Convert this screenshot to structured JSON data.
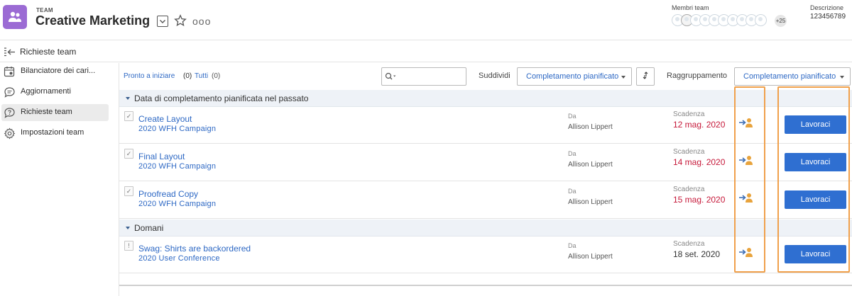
{
  "header": {
    "kicker": "TEAM",
    "title": "Creative Marketing",
    "more_glyph": "ooo",
    "members_label": "Membri team",
    "members_extra": "+25",
    "description_label": "Descrizione",
    "description_value": "123456789"
  },
  "breadcrumb": {
    "label": "Richieste team"
  },
  "sidebar": {
    "items": [
      {
        "label": "Bilanciatore dei cari...",
        "icon": "calendar-people-icon",
        "active": false
      },
      {
        "label": "Aggiornamenti",
        "icon": "speech-bubble-icon",
        "active": false
      },
      {
        "label": "Richieste team",
        "icon": "request-bubble-icon",
        "active": true
      },
      {
        "label": "Impostazioni team",
        "icon": "gear-icon",
        "active": false
      }
    ]
  },
  "toolbar": {
    "filter_ready": "Pronto a iniziare",
    "filter_ready_count": "(0)",
    "filter_all": "Tutti",
    "filter_all_count": "(0)",
    "search_value": "",
    "sort_label": "Suddividi",
    "sort_value": "Completamento pianificato",
    "group_label": "Raggruppamento",
    "group_value": "Completamento pianificato"
  },
  "groups": [
    {
      "title": "Data di completamento pianificata nel passato",
      "rows": [
        {
          "icon_glyph": "✓",
          "title": "Create Layout",
          "project": "2020 WFH Campaign",
          "from_label": "Da",
          "from": "Allison Lippert",
          "due_label": "Scadenza",
          "due": "12 mag. 2020",
          "late": true,
          "button": "Lavoraci"
        },
        {
          "icon_glyph": "✓",
          "title": "Final Layout",
          "project": "2020 WFH Campaign",
          "from_label": "Da",
          "from": "Allison Lippert",
          "due_label": "Scadenza",
          "due": "14 mag. 2020",
          "late": true,
          "button": "Lavoraci"
        },
        {
          "icon_glyph": "✓",
          "title": "Proofread Copy",
          "project": "2020 WFH Campaign",
          "from_label": "Da",
          "from": "Allison Lippert",
          "due_label": "Scadenza",
          "due": "15 mag. 2020",
          "late": true,
          "button": "Lavoraci"
        }
      ]
    },
    {
      "title": "Domani",
      "rows": [
        {
          "icon_glyph": "!",
          "title": "Swag: Shirts are backordered",
          "project": "2020 User Conference",
          "from_label": "Da",
          "from": "Allison Lippert",
          "due_label": "Scadenza",
          "due": "18 set. 2020",
          "late": false,
          "button": "Lavoraci"
        }
      ]
    }
  ],
  "colors": {
    "accent": "#2f6fd1",
    "link": "#2d68c4",
    "late_due": "#c6193a",
    "highlight": "#f0a04b",
    "team_logo": "#9b6bd4"
  }
}
